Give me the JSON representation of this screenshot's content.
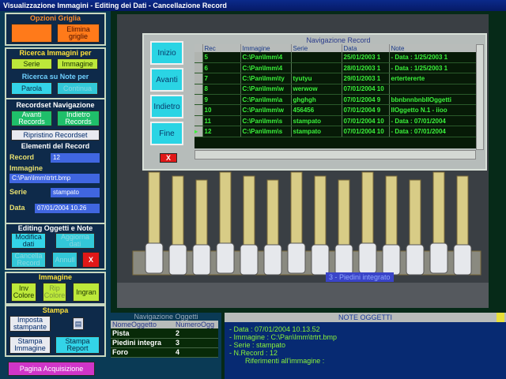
{
  "window": {
    "title": "Visualizzazione Immagini - Editing dei Dati - Cancellazione Record"
  },
  "sidebar": {
    "opzioni_griglia": {
      "title": "Opzioni Griglia",
      "btn_left": "",
      "btn_elimina": "Elimina\ngriglie"
    },
    "ricerca_immagini": {
      "title": "Ricerca Immagini per",
      "serie": "Serie",
      "immagine": "Immagine"
    },
    "ricerca_note": {
      "title": "Ricerca su Note per",
      "parola": "Parola",
      "continua": "Continua"
    },
    "recordset": {
      "title": "Recordset Navigazione",
      "avanti": "Avanti\nRecords",
      "indietro": "Indietro\nRecords",
      "ripristino": "Ripristino Recordset"
    },
    "elementi": {
      "title": "Elementi del Record",
      "record_label": "Record",
      "record_value": "12",
      "immagine_label": "Immagine",
      "immagine_value": "C:\\Pan\\Imm\\trtrt.bmp",
      "serie_label": "Serie",
      "serie_value": "stampato",
      "data_label": "Data",
      "data_value": "07/01/2004 10.26"
    },
    "editing": {
      "title": "Editing Oggetti e Note",
      "modifica": "Modifica\ndati",
      "aggiorna": "Aggiorna\ndati",
      "cancella": "Cancella\nRecord",
      "annulla": "Annull",
      "close": "X"
    },
    "immagine": {
      "title": "Immagine",
      "inv_colore": "Inv\nColore",
      "rip_colore": "Rip\nColore",
      "ingran": "Ingran"
    },
    "stampa": {
      "title": "Stampa",
      "imposta": "Imposta\nstampante",
      "stampa_immagine": "Stampa\nImmagine",
      "stampa_report": "Stampa\nReport"
    },
    "pagina": "Pagina Acquisizione"
  },
  "navigazione_record": {
    "title": "Navigazione Record",
    "buttons": {
      "inizio": "Inizio",
      "avanti": "Avanti",
      "indietro": "Indietro",
      "fine": "Fine",
      "close": "X"
    },
    "columns": [
      "Rec",
      "Immagine",
      "Serie",
      "Data",
      "Note"
    ],
    "rows": [
      [
        "5",
        "C:\\Pan\\Imm\\4",
        "",
        "25/01/2003 1",
        "- Data : 1/25/2003 1"
      ],
      [
        "6",
        "C:\\Pan\\Imm\\4",
        "",
        "28/01/2003 1",
        "- Data : 1/25/2003 1"
      ],
      [
        "7",
        "C:\\Pan\\Imm\\ty",
        "tyutyu",
        "29/01/2003 1",
        "ertertererte"
      ],
      [
        "8",
        "C:\\Pan\\Imm\\w",
        "werwow",
        "07/01/2004 10",
        ""
      ],
      [
        "9",
        "C:\\Pan\\Imm\\a",
        "ghghgh",
        "07/01/2004 9",
        "bbnbnnbnbIIOggetti"
      ],
      [
        "10",
        "C:\\Pan\\Imm\\w",
        "456456",
        "07/01/2004 9",
        "IIOggetto N.1 - iioo"
      ],
      [
        "11",
        "C:\\Pan\\Imm\\s",
        "stampato",
        "07/01/2004 10",
        "- Data : 07/01/2004"
      ],
      [
        "12",
        "C:\\Pan\\Imm\\s",
        "stampato",
        "07/01/2004 10",
        "- Data : 07/01/2004"
      ]
    ]
  },
  "image_caption": "3 - Piedini integrato",
  "navigazione_oggetti": {
    "title": "Navigazione Oggetti",
    "columns": [
      "NomeOggetto",
      "NumeroOgg"
    ],
    "rows": [
      [
        "Pista",
        "2"
      ],
      [
        "Piedini integra",
        "3"
      ],
      [
        "Foro",
        "4"
      ]
    ]
  },
  "note_oggetti": {
    "title": "NOTE OGGETTI",
    "lines": [
      "- Data : 07/01/2004 10.13.52",
      "- Immagine : C:\\Pan\\Imm\\trtrt.bmp",
      "- Serie : stampato",
      "- N.Record : 12",
      "",
      "        Riferimenti all'immagine :"
    ]
  }
}
